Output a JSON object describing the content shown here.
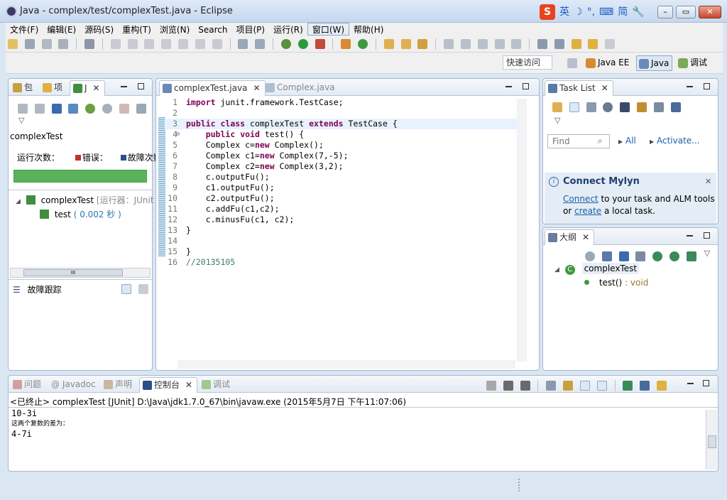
{
  "window": {
    "title": "Java - complex/test/complexTest.java - Eclipse"
  },
  "ime": {
    "logo": "S",
    "lang": "英",
    "moon": "☽",
    "punct": "°,",
    "kbd": "⌨",
    "simp": "简",
    "tool": "🔧"
  },
  "menu": [
    "文件(F)",
    "编辑(E)",
    "源码(S)",
    "重构(T)",
    "浏览(N)",
    "Search",
    "项目(P)",
    "运行(R)",
    "窗口(W)",
    "帮助(H)"
  ],
  "quick_access": "快速访问",
  "perspectives": [
    {
      "label": "Java EE"
    },
    {
      "label": "Java"
    },
    {
      "label": "调试"
    }
  ],
  "left_panel": {
    "tabs": [
      "包",
      "项",
      "J"
    ],
    "title": "complexTest",
    "runs_label": "运行次数：",
    "errors_label": "错误：",
    "failures_label": "故障次数",
    "tree": [
      {
        "name": "complexTest",
        "runner": "[运行器：JUnit"
      },
      {
        "name": "test",
        "time": "( 0.002 秒 )"
      }
    ],
    "failure_trace": "故障跟踪",
    "scroll_label": "III"
  },
  "editor": {
    "tabs": [
      "complexTest.java",
      "Complex.java"
    ],
    "lines": [
      {
        "n": "1",
        "code": "import junit.framework.TestCase;"
      },
      {
        "n": "2",
        "code": ""
      },
      {
        "n": "3",
        "code": "public class complexTest extends TestCase {"
      },
      {
        "n": "4",
        "code": "    public void test() {"
      },
      {
        "n": "5",
        "code": "    Complex c=new Complex();"
      },
      {
        "n": "6",
        "code": "    Complex c1=new Complex(7,-5);"
      },
      {
        "n": "7",
        "code": "    Complex c2=new Complex(3,2);"
      },
      {
        "n": "8",
        "code": "    c.outputFu();"
      },
      {
        "n": "9",
        "code": "    c1.outputFu();"
      },
      {
        "n": "10",
        "code": "    c2.outputFu();"
      },
      {
        "n": "11",
        "code": "    c.addFu(c1,c2);"
      },
      {
        "n": "12",
        "code": "    c.minusFu(c1, c2);"
      },
      {
        "n": "13",
        "code": "}"
      },
      {
        "n": "14",
        "code": ""
      },
      {
        "n": "15",
        "code": "}"
      },
      {
        "n": "16",
        "code": "//20135105"
      }
    ]
  },
  "tasklist": {
    "tab": "Task List",
    "find_placeholder": "Find",
    "all": "All",
    "activate": "Activate...",
    "mylyn_title": "Connect Mylyn",
    "mylyn_connect": "Connect",
    "mylyn_text1": " to your task and ALM tools",
    "mylyn_or": "or ",
    "mylyn_create": "create",
    "mylyn_text2": " a local task."
  },
  "outline": {
    "tab": "大纲",
    "class_name": "complexTest",
    "method": "test()",
    "return_type": " : void"
  },
  "console": {
    "tabs": [
      "问题",
      "@ Javadoc",
      "声明",
      "控制台",
      "调试"
    ],
    "header": "<已终止> complexTest [JUnit] D:\\Java\\jdk1.7.0_67\\bin\\javaw.exe (2015年5月7日 下午11:07:06)",
    "lines": [
      "10-3i",
      "这两个复数的差为：",
      "4-7i"
    ]
  },
  "colors": {
    "junit_bar": "#5ab35a",
    "keyword": "#7f0055",
    "comment": "#3f7f5f"
  }
}
